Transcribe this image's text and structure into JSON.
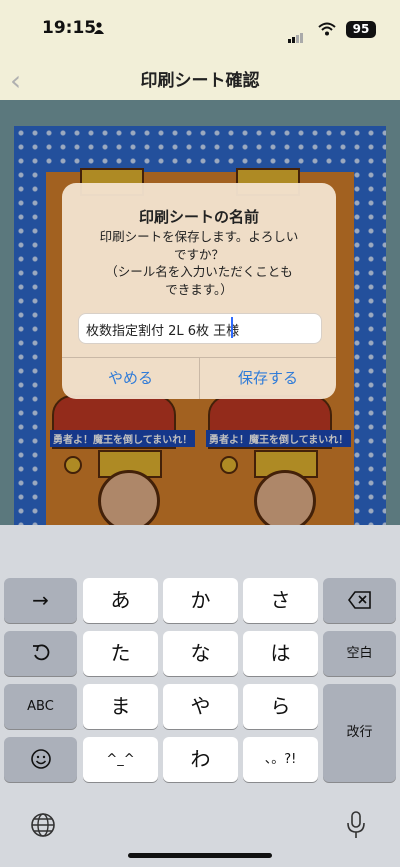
{
  "status_bar": {
    "time": "19:15",
    "battery": "95"
  },
  "nav": {
    "back_icon": "chevron-left-icon",
    "title": "印刷シート確認"
  },
  "sheet": {
    "caption": "勇者よ！魔王を倒してまいれ！"
  },
  "dialog": {
    "title": "印刷シートの名前",
    "message": "印刷シートを保存します。よろしい\nですか？\n（シール名を入力いただくことも\nできます。）",
    "input_value": "枚数指定割付 2L 6枚 王様",
    "cancel_label": "やめる",
    "save_label": "保存する"
  },
  "keyboard": {
    "row1": {
      "left": "→",
      "keys": [
        "あ",
        "か",
        "さ"
      ],
      "right_icon": "backspace-icon"
    },
    "row2": {
      "left_icon": "undo-icon",
      "keys": [
        "た",
        "な",
        "は"
      ],
      "right": "空白"
    },
    "row3": {
      "left": "ABC",
      "keys": [
        "ま",
        "や",
        "ら"
      ],
      "right": "改行"
    },
    "row4": {
      "left_icon": "emoji-icon",
      "keys": [
        "^_^",
        "わ",
        "、。?!"
      ]
    },
    "globe_icon": "globe-icon",
    "mic_icon": "microphone-icon"
  }
}
